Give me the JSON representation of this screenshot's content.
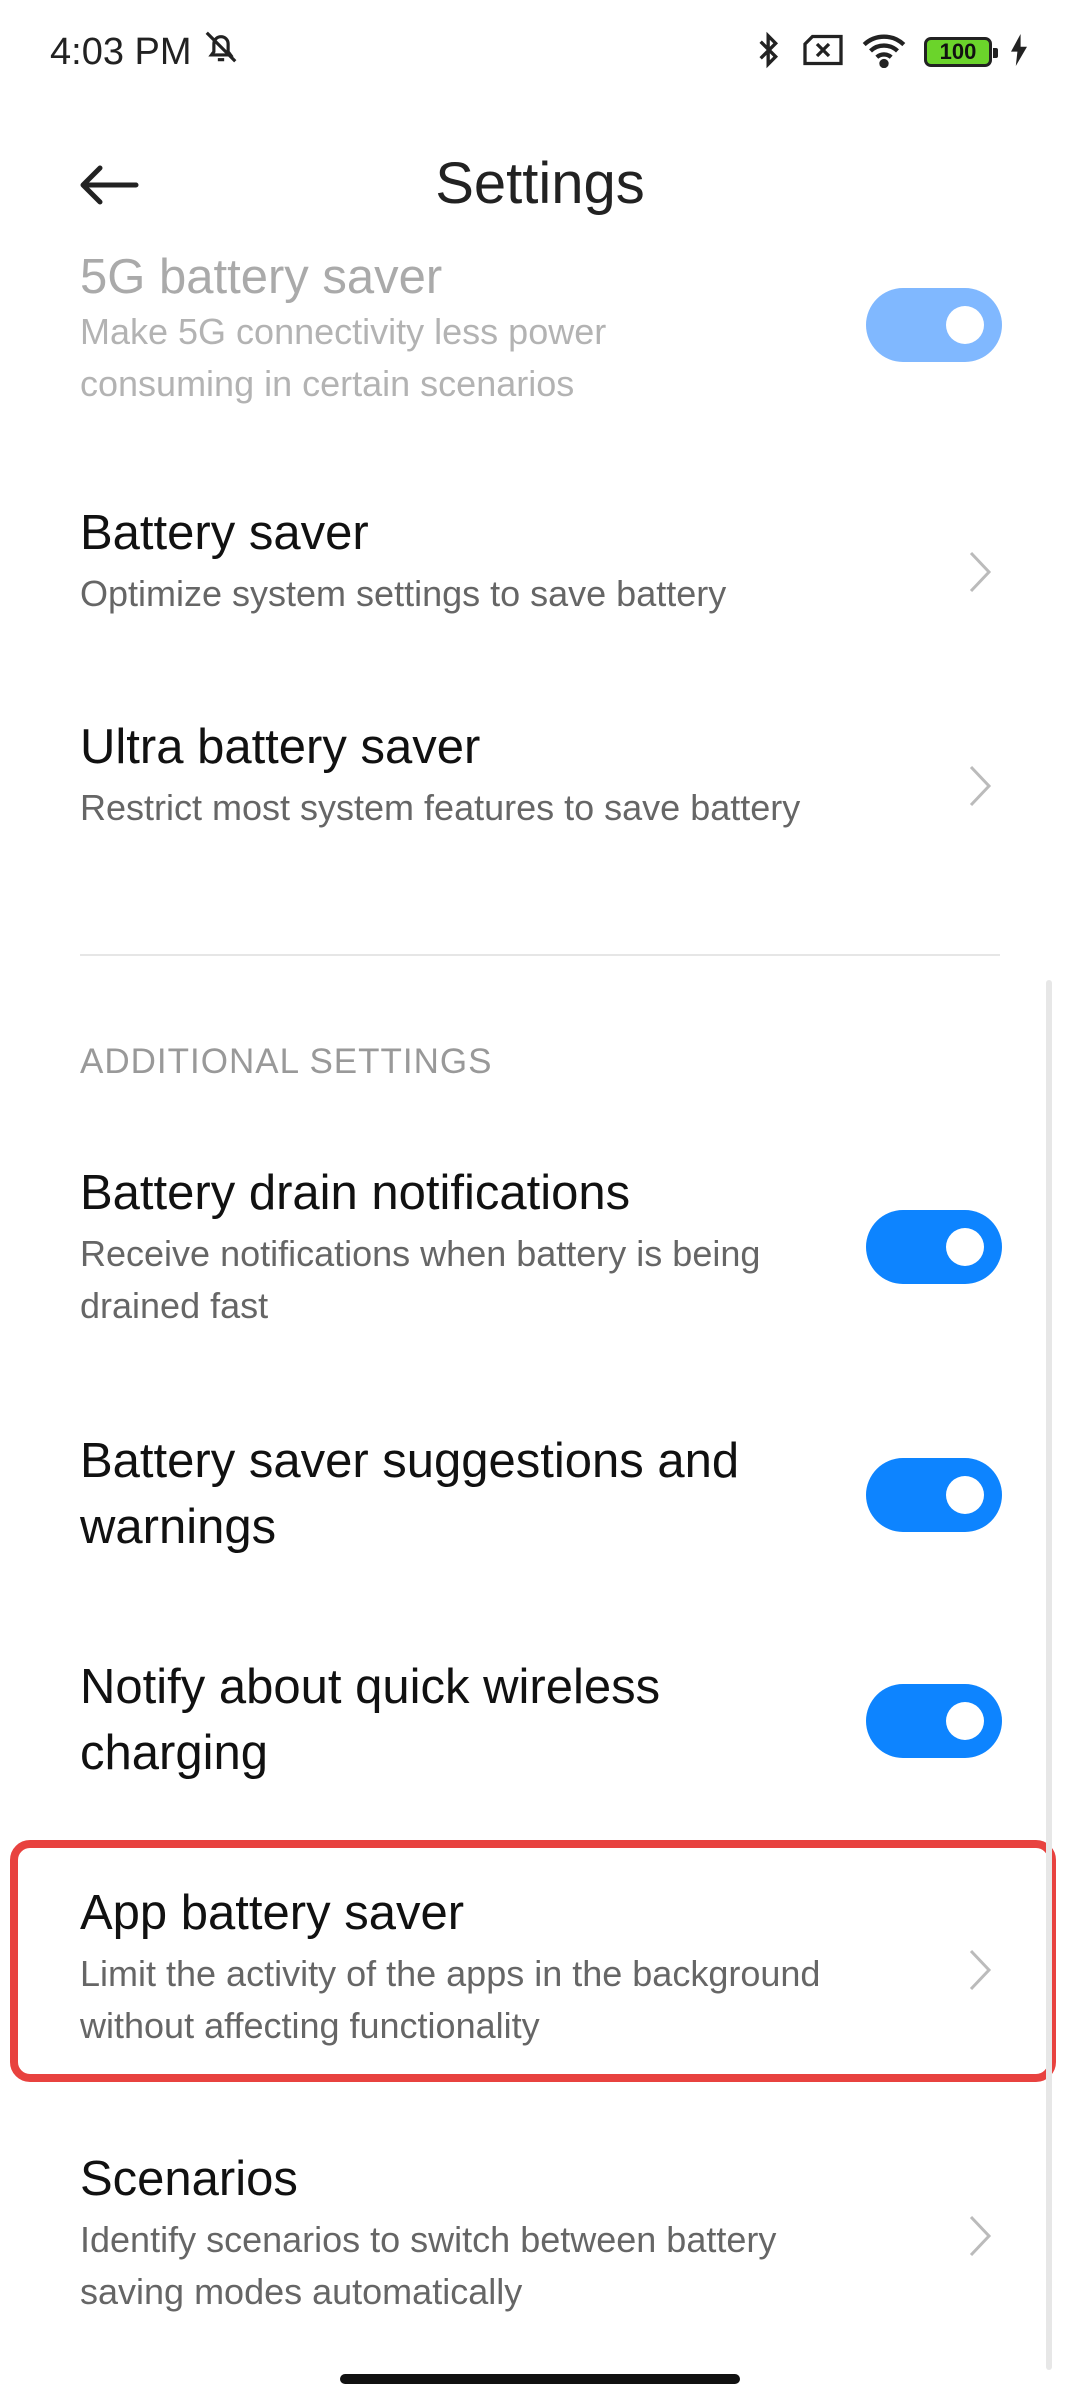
{
  "status_bar": {
    "time": "4:03 PM",
    "battery_level": "100",
    "icons": [
      "mute-bell-icon",
      "bluetooth-icon",
      "no-sim-icon",
      "wifi-icon",
      "battery-icon",
      "charging-icon"
    ]
  },
  "header": {
    "title": "Settings",
    "back_icon": "back-arrow-icon"
  },
  "items": [
    {
      "title": "5G battery saver",
      "subtitle": "Make 5G connectivity less power consuming in certain scenarios",
      "control": "toggle",
      "on": true,
      "faded": true
    },
    {
      "title": "Battery saver",
      "subtitle": "Optimize system settings to save battery",
      "control": "chevron"
    },
    {
      "title": "Ultra battery saver",
      "subtitle": "Restrict most system features to save battery",
      "control": "chevron"
    }
  ],
  "section": {
    "label": "ADDITIONAL SETTINGS"
  },
  "additional_items": [
    {
      "title": "Battery drain notifications",
      "subtitle": "Receive notifications when battery is being drained fast",
      "control": "toggle",
      "on": true
    },
    {
      "title": "Battery saver suggestions and warnings",
      "control": "toggle",
      "on": true
    },
    {
      "title": "Notify about quick wireless charging",
      "control": "toggle",
      "on": true
    },
    {
      "title": "App battery saver",
      "subtitle": "Limit the activity of the apps in the background without affecting functionality",
      "control": "chevron",
      "highlighted": true
    },
    {
      "title": "Scenarios",
      "subtitle": "Identify scenarios to switch between battery saving modes automatically",
      "control": "chevron"
    }
  ],
  "colors": {
    "accent": "#0D84FF",
    "highlight": "#E8423F",
    "battery_fill": "#6BD42B"
  }
}
